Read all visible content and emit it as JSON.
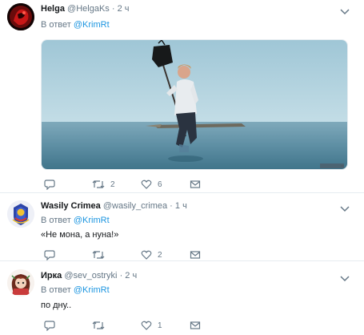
{
  "tweets": [
    {
      "name": "Helga",
      "handle": "@HelgaKs",
      "sep": "·",
      "time": "2 ч",
      "reply_prefix": "В ответ",
      "reply_to": "@KrimRt",
      "text": "",
      "counts": {
        "reply": "",
        "retweet": "2",
        "like": "6",
        "dm": ""
      }
    },
    {
      "name": "Wasily Crimea",
      "handle": "@wasily_crimea",
      "sep": "·",
      "time": "1 ч",
      "reply_prefix": "В ответ",
      "reply_to": "@KrimRt",
      "text": "«Не мона, а нуна!»",
      "counts": {
        "reply": "",
        "retweet": "",
        "like": "2",
        "dm": ""
      }
    },
    {
      "name": "Ирка",
      "handle": "@sev_ostryki",
      "sep": "·",
      "time": "2 ч",
      "reply_prefix": "В ответ",
      "reply_to": "@KrimRt",
      "text": "по дну..",
      "counts": {
        "reply": "",
        "retweet": "",
        "like": "1",
        "dm": ""
      }
    }
  ],
  "media": {
    "watermark": ""
  },
  "colors": {
    "accent": "#1b95e0",
    "muted": "#657786",
    "text": "#14171a",
    "border": "#e6ecf0"
  },
  "icons": [
    "reply-icon",
    "retweet-icon",
    "like-icon",
    "direct-message-icon",
    "chevron-down-icon"
  ]
}
